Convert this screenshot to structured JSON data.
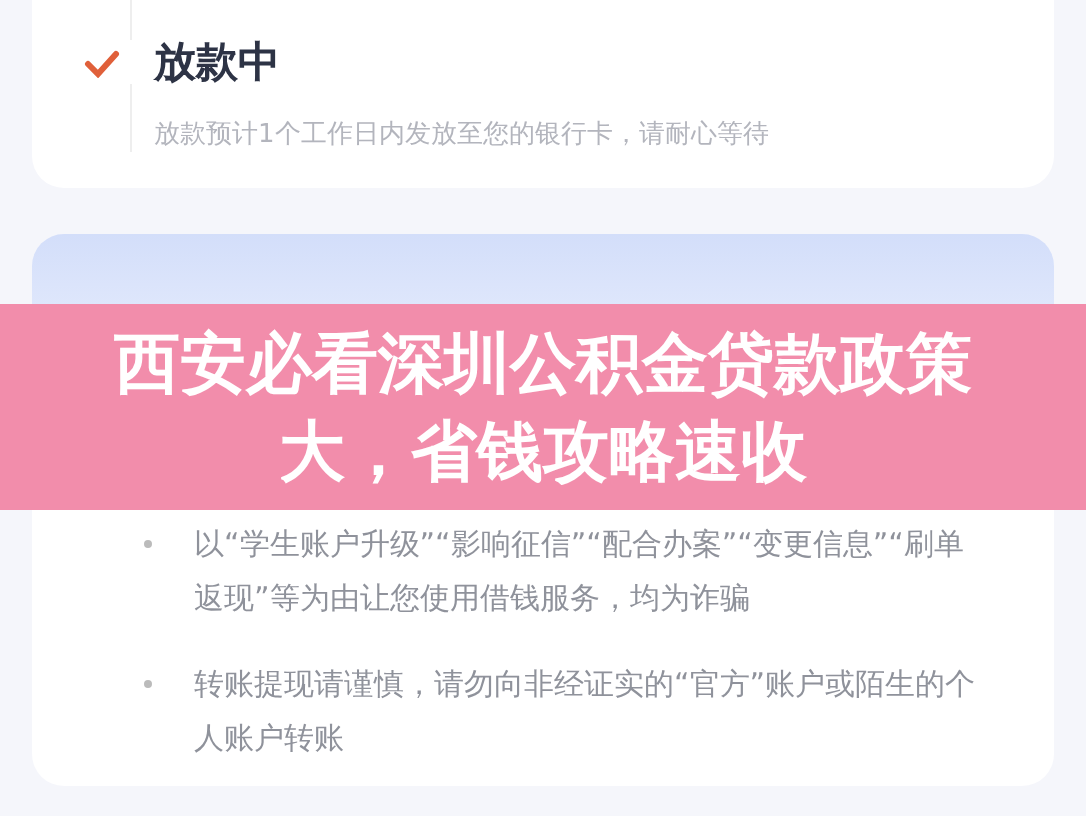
{
  "status_step": {
    "title": "放款中",
    "description": "放款预计1个工作日内发放至您的银行卡，请耐心等待",
    "done": true
  },
  "notice": {
    "items": [
      "以“学生账户升级”“影响征信”“配合办案”“变更信息”“刷单返现”等为由让您使用借钱服务，均为诈骗",
      "转账提现请谨慎，请勿向非经证实的“官方”账户或陌生的个人账户转账"
    ]
  },
  "banner": {
    "title": "西安必看深圳公积金贷款政策大，省钱攻略速收"
  }
}
